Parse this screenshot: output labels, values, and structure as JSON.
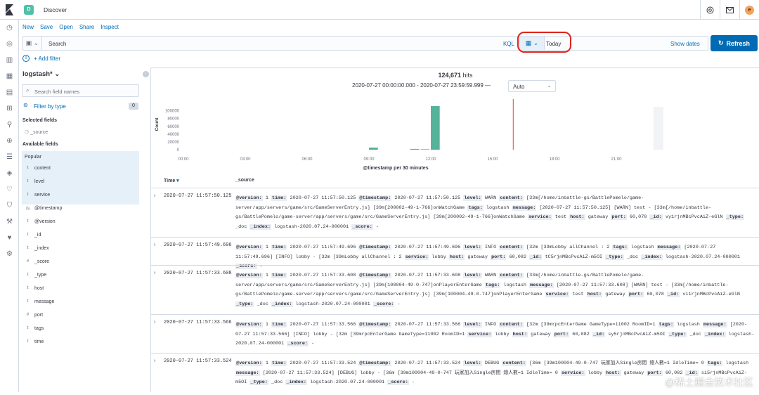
{
  "header": {
    "space": "D",
    "title": "Discover",
    "avatar": "e"
  },
  "menu": [
    "New",
    "Save",
    "Open",
    "Share",
    "Inspect"
  ],
  "query": {
    "placeholder": "Search",
    "lang": "KQL",
    "date": "Today",
    "show_dates": "Show dates",
    "refresh": "Refresh"
  },
  "filters": {
    "add": "+ Add filter"
  },
  "sidebar": {
    "index": "logstash*",
    "search_placeholder": "Search field names",
    "filter_by_type": "Filter by type",
    "filter_count": "0",
    "selected_title": "Selected fields",
    "selected_field": "_source",
    "available_title": "Available fields",
    "popular_title": "Popular",
    "fields": [
      {
        "type": "t",
        "name": "content"
      },
      {
        "type": "t",
        "name": "level"
      },
      {
        "type": "t",
        "name": "service"
      },
      {
        "type": "clock",
        "name": "@timestamp"
      },
      {
        "type": "t",
        "name": "@version"
      },
      {
        "type": "t",
        "name": "_id"
      },
      {
        "type": "t",
        "name": "_index"
      },
      {
        "type": "#",
        "name": "_score"
      },
      {
        "type": "t",
        "name": "_type"
      },
      {
        "type": "t",
        "name": "host"
      },
      {
        "type": "t",
        "name": "message"
      },
      {
        "type": "#",
        "name": "port"
      },
      {
        "type": "t",
        "name": "tags"
      },
      {
        "type": "t",
        "name": "time"
      }
    ]
  },
  "summary": {
    "hits": "124,671",
    "hits_label": "hits",
    "range": "2020-07-27 00:00:00.000 - 2020-07-27 23:59:59.999 —",
    "interval": "Auto"
  },
  "chart_data": {
    "type": "bar",
    "ylabel": "Count",
    "xlabel": "@timestamp per 30 minutes",
    "yticks": [
      "0",
      "20000",
      "40000",
      "60000",
      "80000",
      "100000"
    ],
    "xticks": [
      "00:00",
      "03:00",
      "06:00",
      "09:00",
      "12:00",
      "15:00",
      "18:00",
      "21:00"
    ],
    "ylim": [
      0,
      130000
    ],
    "xlim": [
      0,
      24
    ],
    "bars": [
      {
        "x": 9.0,
        "value": 5500
      },
      {
        "x": 11.0,
        "value": 2000
      },
      {
        "x": 11.5,
        "value": 1200
      },
      {
        "x": 12.0,
        "value": 112000
      }
    ],
    "current_time_marker": 16.0,
    "bar_color": "#54b399",
    "marker_color": "#e7664c"
  },
  "table": {
    "time_header": "Time",
    "source_header": "_source"
  },
  "rows": [
    {
      "time": "2020-07-27 11:57:50.125",
      "pairs": [
        [
          "@version:",
          "1"
        ],
        [
          "time:",
          "2020-07-27 11:57:50.125"
        ],
        [
          "@timestamp:",
          "2020-07-27 11:57:50.125"
        ],
        [
          "level:",
          "WARN"
        ],
        [
          "content:",
          "[33m[/home/inbattle-gs/BattlePomelo/game-server/app/servers/game/src/GameServerEntry.js] [39m[200002-49-1-766]onWatchGame"
        ],
        [
          "tags:",
          "logstash"
        ],
        [
          "message:",
          "[2020-07-27 11:57:50.125] [WARN] test - [33m[/home/inbattle-gs/BattlePomelo/game-server/app/servers/game/src/GameServerEntry.js] [39m[200002-49-1-766]onWatchGame"
        ],
        [
          "service:",
          "test"
        ],
        [
          "host:",
          "gateway"
        ],
        [
          "port:",
          "60,078"
        ],
        [
          "_id:",
          "vy1rjnMBcPvcAiZ-eGlN"
        ],
        [
          "_type:",
          "_doc"
        ],
        [
          "_index:",
          "logstash-2020.07.24-000001"
        ],
        [
          "_score:",
          "-"
        ]
      ]
    },
    {
      "time": "2020-07-27 11:57:49.696",
      "pairs": [
        [
          "@version:",
          "1"
        ],
        [
          "time:",
          "2020-07-27 11:57:49.696"
        ],
        [
          "@timestamp:",
          "2020-07-27 11:57:49.696"
        ],
        [
          "level:",
          "INFO"
        ],
        [
          "content:",
          "[32m [39mLobby allChannel : 2"
        ],
        [
          "tags:",
          "logstash"
        ],
        [
          "message:",
          "[2020-07-27 11:57:49.696] [INFO] lobby - [32m [39mLobby allChannel : 2"
        ],
        [
          "service:",
          "lobby"
        ],
        [
          "host:",
          "gateway"
        ],
        [
          "port:",
          "60,082"
        ],
        [
          "_id:",
          "tC5rjnMBcPvcAiZ-m5OI"
        ],
        [
          "_type:",
          "_doc"
        ],
        [
          "_index:",
          "logstash-2020.07.24-000001"
        ],
        [
          "_score:",
          "-"
        ]
      ]
    },
    {
      "time": "2020-07-27 11:57:33.608",
      "pairs": [
        [
          "@version:",
          "1"
        ],
        [
          "time:",
          "2020-07-27 11:57:33.608"
        ],
        [
          "@timestamp:",
          "2020-07-27 11:57:33.608"
        ],
        [
          "level:",
          "WARN"
        ],
        [
          "content:",
          "[33m[/home/inbattle-gs/BattlePomelo/game-server/app/servers/game/src/GameServerEntry.js] [39m[100004-49-0-747]onPlayerEnterGame"
        ],
        [
          "tags:",
          "logstash"
        ],
        [
          "message:",
          "[2020-07-27 11:57:33.608] [WARN] test - [33m[/home/inbattle-gs/BattlePomelo/game-server/app/servers/game/src/GameServerEntry.js] [39m[100004-49-0-747]onPlayerEnterGame"
        ],
        [
          "service:",
          "test"
        ],
        [
          "host:",
          "gateway"
        ],
        [
          "port:",
          "60,078"
        ],
        [
          "_id:",
          "vi1rjnMBcPvcAiZ-eGlN"
        ],
        [
          "_type:",
          "_doc"
        ],
        [
          "_index:",
          "logstash-2020.07.24-000001"
        ],
        [
          "_score:",
          "-"
        ]
      ]
    },
    {
      "time": "2020-07-27 11:57:33.566",
      "pairs": [
        [
          "@version:",
          "1"
        ],
        [
          "time:",
          "2020-07-27 11:57:33.566"
        ],
        [
          "@timestamp:",
          "2020-07-27 11:57:33.566"
        ],
        [
          "level:",
          "INFO"
        ],
        [
          "content:",
          "[32m [39mrpcEnterGame GameType=11002 RoomID=1"
        ],
        [
          "tags:",
          "logstash"
        ],
        [
          "message:",
          "[2020-07-27 11:57:33.566] [INFO] lobby - [32m [39mrpcEnterGame GameType=11002 RoomID=1"
        ],
        [
          "service:",
          "lobby"
        ],
        [
          "host:",
          "gateway"
        ],
        [
          "port:",
          "60,082"
        ],
        [
          "_id:",
          "sy5rjnMBcPvcAiZ-m5OI"
        ],
        [
          "_type:",
          "_doc"
        ],
        [
          "_index:",
          "logstash-2020.07.24-000001"
        ],
        [
          "_score:",
          "-"
        ]
      ]
    },
    {
      "time": "2020-07-27 11:57:33.524",
      "pairs": [
        [
          "@version:",
          "1"
        ],
        [
          "time:",
          "2020-07-27 11:57:33.524"
        ],
        [
          "@timestamp:",
          "2020-07-27 11:57:33.524"
        ],
        [
          "level:",
          "DEBUG"
        ],
        [
          "content:",
          "[36m [39m100004-49-0-747 玩家加入Single房間 總人數=1 IdleTime= 0"
        ],
        [
          "tags:",
          "logstash"
        ],
        [
          "message:",
          "[2020-07-27 11:57:33.524] [DEBUG] lobby - [36m [39m100004-49-0-747 玩家加入Single房間 總人數=1 IdleTime= 0"
        ],
        [
          "service:",
          "lobby"
        ],
        [
          "host:",
          "gateway"
        ],
        [
          "port:",
          "60,082"
        ],
        [
          "_id:",
          "si5rjnMBcPvcAiZ-m5OI"
        ],
        [
          "_type:",
          "_doc"
        ],
        [
          "_index:",
          "logstash-2020.07.24-000001"
        ],
        [
          "_score:",
          "-"
        ]
      ]
    }
  ],
  "watermark": "@稀土掘金技术社区"
}
